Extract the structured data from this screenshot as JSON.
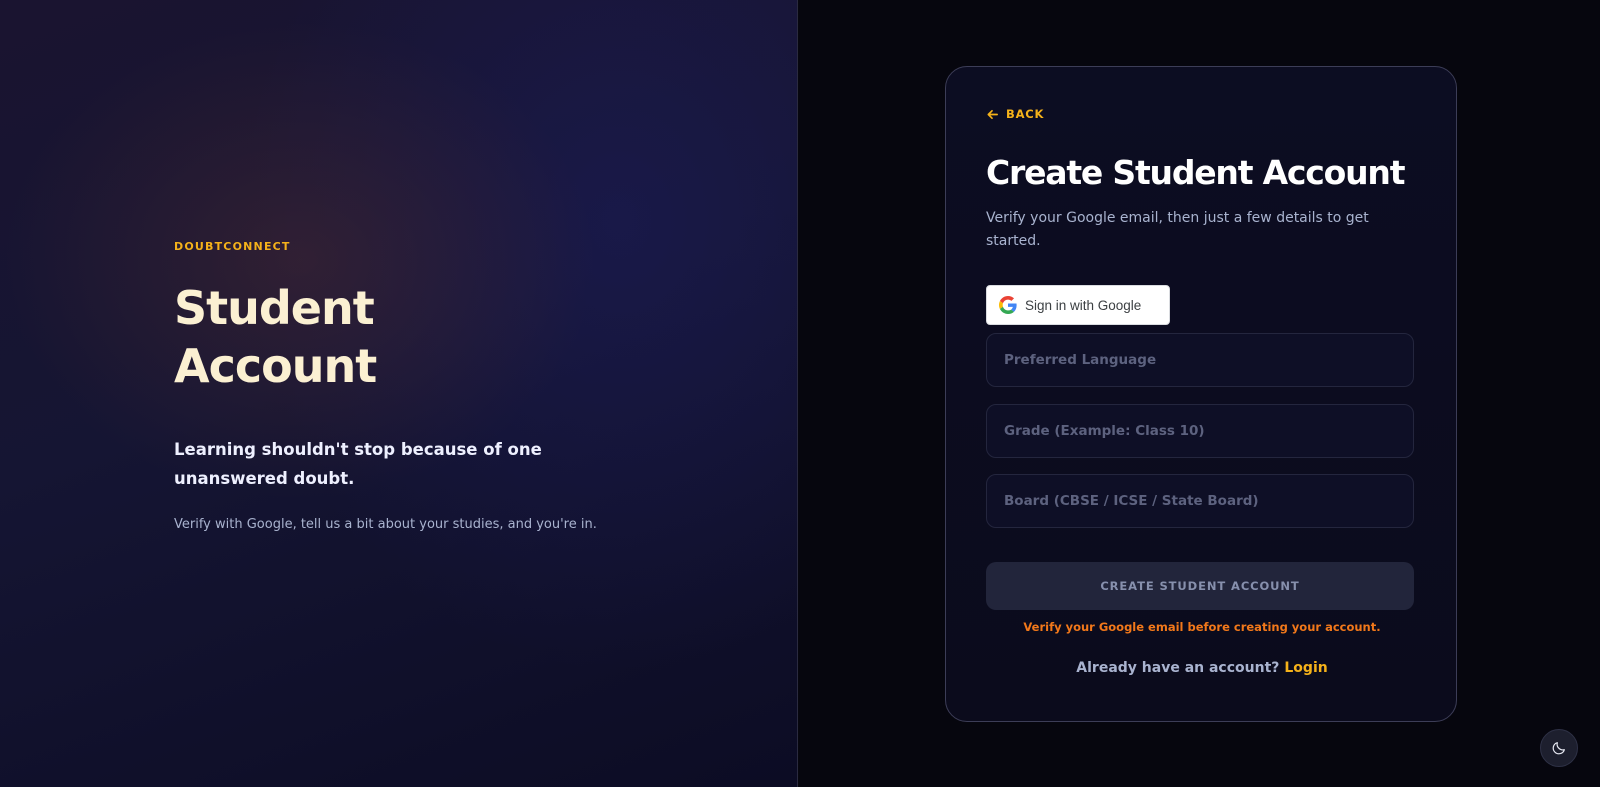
{
  "left": {
    "brand": "DOUBTCONNECT",
    "title": "Student Account",
    "tagline": "Learning shouldn't stop because of one unanswered doubt.",
    "subtext": "Verify with Google, tell us a bit about your studies, and you're in."
  },
  "card": {
    "back_label": "BACK",
    "title": "Create Student Account",
    "subtitle": "Verify your Google email, then just a few details to get started.",
    "google_button_label": "Sign in with Google",
    "fields": {
      "language_placeholder": "Preferred Language",
      "grade_placeholder": "Grade (Example: Class 10)",
      "board_placeholder": "Board (CBSE / ICSE / State Board)"
    },
    "submit_label": "CREATE STUDENT ACCOUNT",
    "warning": "Verify your Google email before creating your account.",
    "login_prompt": "Already have an account?",
    "login_link": "Login"
  },
  "icons": {
    "back": "arrow-left-icon",
    "google": "google-g-icon",
    "theme": "moon-icon"
  },
  "colors": {
    "accent": "#f5b21a",
    "warning": "#f2781a",
    "hero_title": "#fbf0d2"
  }
}
